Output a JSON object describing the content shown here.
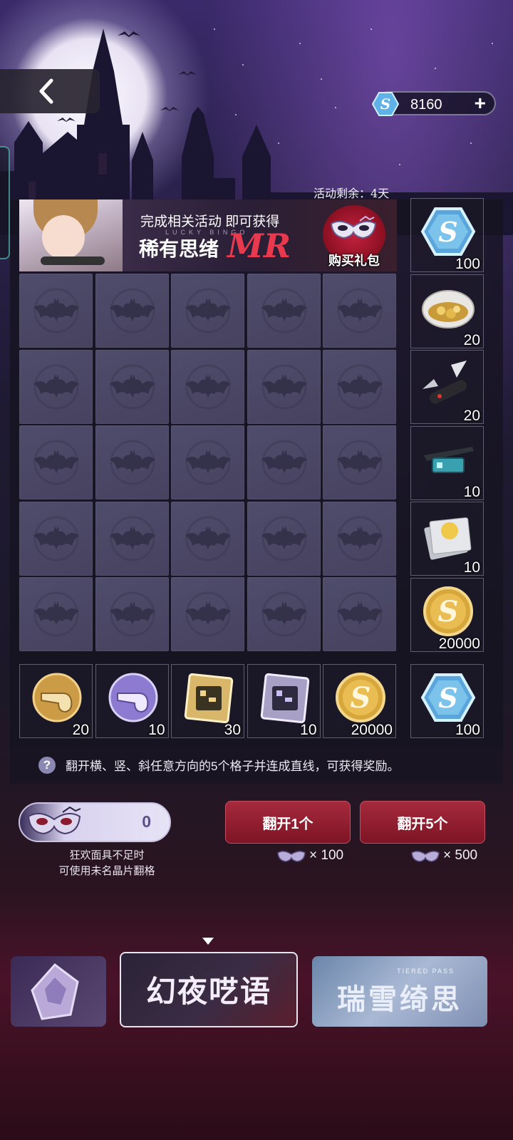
{
  "header": {
    "back_icon": "chevron-left-icon",
    "currency": {
      "icon": "s-crystal-icon",
      "amount": "8160",
      "add_label": "+"
    }
  },
  "event": {
    "remaining": "活动剩余：4天",
    "banner": {
      "line1": "完成相关活动 即可获得",
      "tag": "LUCKY BINGO",
      "line2": "稀有思绪",
      "rarity": "MR",
      "buy_label": "购买礼包"
    }
  },
  "board": {
    "rows": 5,
    "cols": 5,
    "cell_state": "face-down",
    "cell_icon": "bat-icon"
  },
  "rewards": {
    "right_column": [
      {
        "icon": "s-crystal-icon",
        "qty": "100"
      },
      {
        "icon": "gold-nugget-dish-icon",
        "qty": "20"
      },
      {
        "icon": "pocket-knife-icon",
        "qty": "20"
      },
      {
        "icon": "tech-glasses-icon",
        "qty": "10"
      },
      {
        "icon": "card-pack-icon",
        "qty": "10"
      },
      {
        "icon": "gold-s-coin-icon",
        "qty": "20000"
      }
    ],
    "bottom_row": [
      {
        "icon": "gold-pipe-icon",
        "qty": "20"
      },
      {
        "icon": "purple-pipe-icon",
        "qty": "10"
      },
      {
        "icon": "gold-chip-icon",
        "qty": "30"
      },
      {
        "icon": "purple-chip-icon",
        "qty": "10"
      },
      {
        "icon": "gold-s-coin-icon",
        "qty": "20000"
      }
    ],
    "diagonal": {
      "icon": "s-crystal-icon",
      "qty": "100"
    }
  },
  "hint": "翻开横、竖、斜任意方向的5个格子并连成直线，可获得奖励。",
  "controls": {
    "mask_count": "0",
    "mask_note_line1": "狂欢面具不足时",
    "mask_note_line2": "可使用未名晶片翻格",
    "flip_one": {
      "label": "翻开1个",
      "cost": "× 100"
    },
    "flip_five": {
      "label": "翻开5个",
      "cost": "× 500"
    }
  },
  "carousel": {
    "left_title": "",
    "center_title": "幻夜呓语",
    "right_title": "瑞雪绮思",
    "right_sub": "TIERED PASS"
  },
  "colors": {
    "accent_red": "#a52a3c",
    "cell": "#4f4c6c",
    "panel": "#161421"
  }
}
